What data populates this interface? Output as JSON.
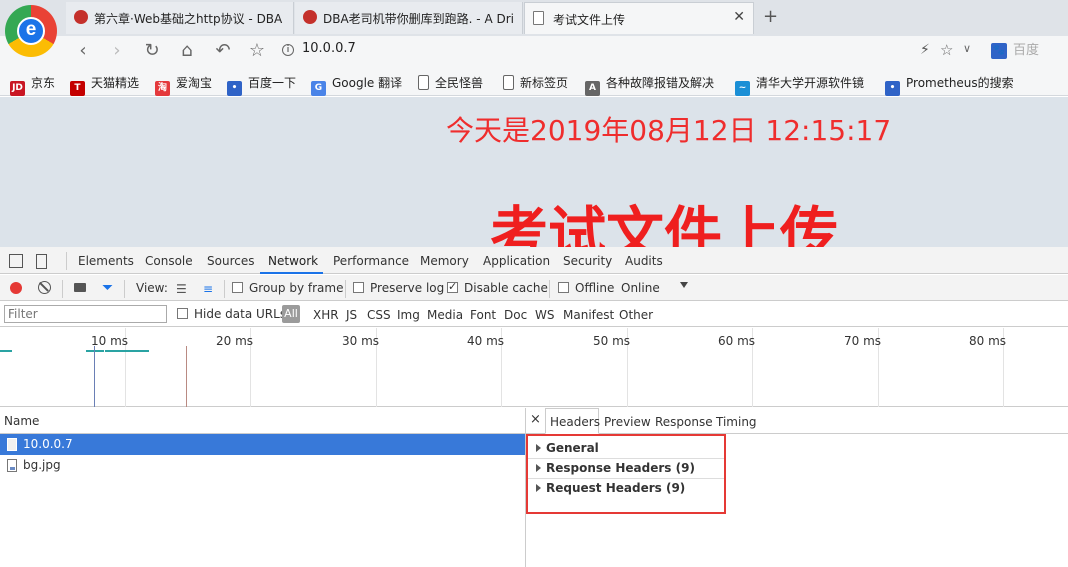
{
  "browser": {
    "tabs": [
      {
        "label": "第六章·Web基础之http协议 - DBA",
        "icon": "rose-icon",
        "active": false
      },
      {
        "label": "DBA老司机带你删库到跑路. - A Dri",
        "icon": "rose-icon",
        "active": false
      },
      {
        "label": "考试文件上传",
        "icon": "document-icon",
        "active": true
      }
    ],
    "close_glyph": "✕",
    "newtab_glyph": "+",
    "address": "10.0.0.7",
    "search_placeholder": "百度",
    "bookmarks": [
      {
        "label": "京东",
        "icon": "JD",
        "color": "#c91623"
      },
      {
        "label": "天猫精选",
        "icon": "T",
        "color": "#c40000"
      },
      {
        "label": "爱淘宝",
        "icon": "淘",
        "color": "#e4393c"
      },
      {
        "label": "百度一下",
        "icon": "paw",
        "color": "#2f63c7"
      },
      {
        "label": "Google 翻译",
        "icon": "G",
        "color": "#4a84e8"
      },
      {
        "label": "全民怪兽",
        "icon": "doc",
        "color": "#ffffff"
      },
      {
        "label": "新标签页",
        "icon": "doc",
        "color": "#ffffff"
      },
      {
        "label": "各种故障报错及解决",
        "icon": "A",
        "color": "#666666"
      },
      {
        "label": "清华大学开源软件镜",
        "icon": "fish",
        "color": "#1a8fd6"
      },
      {
        "label": "Prometheus的搜索",
        "icon": "paw",
        "color": "#2f63c7"
      }
    ]
  },
  "page": {
    "datetime": "今天是2019年08月12日 12:15:17",
    "title": "考试文件上传"
  },
  "devtools": {
    "tabs": [
      "Elements",
      "Console",
      "Sources",
      "Network",
      "Performance",
      "Memory",
      "Application",
      "Security",
      "Audits"
    ],
    "active_tab": "Network",
    "toolbar": {
      "view_label": "View:",
      "group_by_frame": "Group by frame",
      "preserve_log": "Preserve log",
      "disable_cache": "Disable cache",
      "offline": "Offline",
      "throttle": "Online"
    },
    "filter": {
      "placeholder": "Filter",
      "hide_data_urls": "Hide data URLs",
      "all": "All",
      "types": [
        "XHR",
        "JS",
        "CSS",
        "Img",
        "Media",
        "Font",
        "Doc",
        "WS",
        "Manifest",
        "Other"
      ]
    },
    "timeline_ticks": [
      "10 ms",
      "20 ms",
      "30 ms",
      "40 ms",
      "50 ms",
      "60 ms",
      "70 ms",
      "80 ms"
    ],
    "list": {
      "header": "Name",
      "rows": [
        {
          "name": "10.0.0.7",
          "selected": true
        },
        {
          "name": "bg.jpg",
          "selected": false
        }
      ]
    },
    "detail": {
      "close": "×",
      "tabs": [
        "Headers",
        "Preview",
        "Response",
        "Timing"
      ],
      "active_tab": "Headers",
      "sections": [
        "General",
        "Response Headers (9)",
        "Request Headers (9)"
      ]
    }
  },
  "colors": {
    "highlight_box": "#e53935",
    "selected_row": "#3879d9",
    "page_text": "#ef2d2d",
    "record_button": "#e53935"
  }
}
